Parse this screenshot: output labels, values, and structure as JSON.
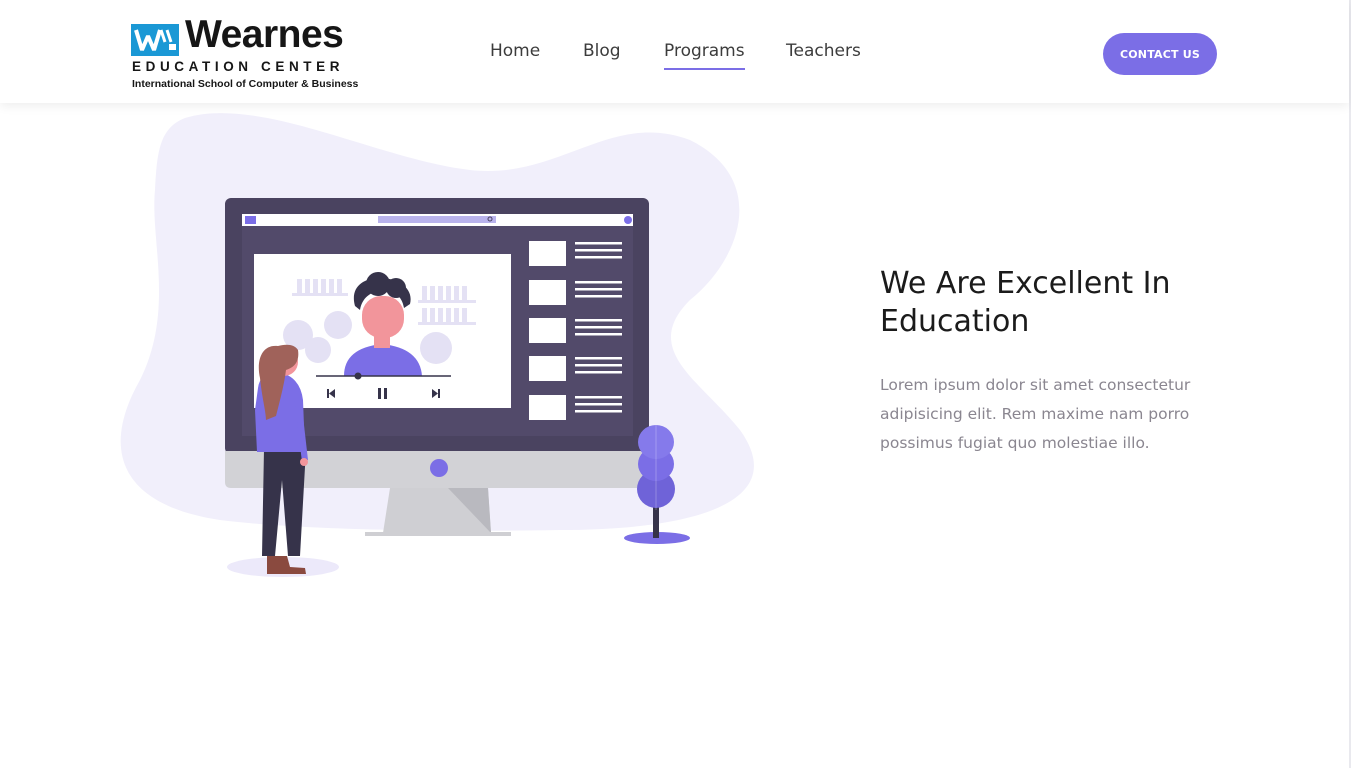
{
  "brand": {
    "name": "Wearnes",
    "subtitle": "EDUCATION CENTER",
    "tagline": "International School of Computer & Business"
  },
  "nav": {
    "items": [
      {
        "label": "Home",
        "active": false
      },
      {
        "label": "Blog",
        "active": false
      },
      {
        "label": "Programs",
        "active": true
      },
      {
        "label": "Teachers",
        "active": false
      }
    ]
  },
  "header": {
    "contact_label": "Contact Us"
  },
  "hero": {
    "title": "We Are Excellent In Education",
    "description": "Lorem ipsum dolor sit amet consectetur adipisicing elit. Rem maxime nam porro possimus fugiat quo molestiae illo."
  },
  "colors": {
    "accent": "#7b6ee6",
    "monitor": "#4a4360",
    "blob": "#f1effb",
    "logo_blue": "#1a98d5"
  }
}
